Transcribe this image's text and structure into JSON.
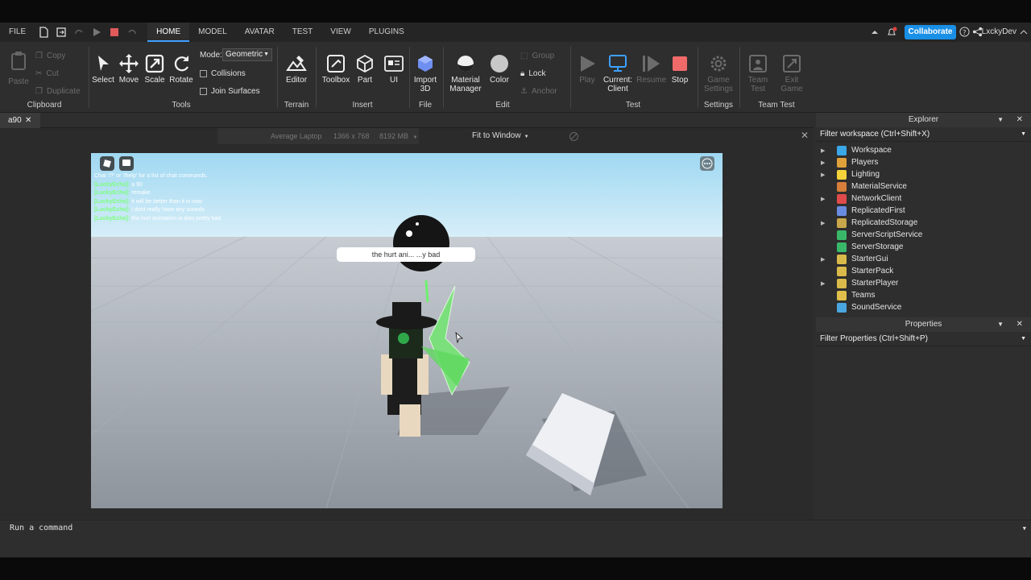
{
  "menu": {
    "file": "FILE",
    "tabs": [
      "HOME",
      "MODEL",
      "AVATAR",
      "TEST",
      "VIEW",
      "PLUGINS"
    ],
    "active_tab": "HOME",
    "collaborate": "Collaborate",
    "username": "LxckyDev"
  },
  "ribbon": {
    "clipboard": {
      "paste": "Paste",
      "copy": "Copy",
      "cut": "Cut",
      "duplicate": "Duplicate",
      "group": "Clipboard"
    },
    "tools": {
      "select": "Select",
      "move": "Move",
      "scale": "Scale",
      "rotate": "Rotate",
      "mode_label": "Mode:",
      "mode_value": "Geometric",
      "collisions": "Collisions",
      "join_surfaces": "Join Surfaces",
      "group": "Tools"
    },
    "terrain": {
      "editor": "Editor",
      "group": "Terrain"
    },
    "insert": {
      "toolbox": "Toolbox",
      "part": "Part",
      "ui": "UI",
      "group": "Insert"
    },
    "file": {
      "import_line1": "Import",
      "import_line2": "3D",
      "group": "File"
    },
    "edit": {
      "material_line1": "Material",
      "material_line2": "Manager",
      "color": "Color",
      "group_btn": "Group",
      "lock": "Lock",
      "anchor": "Anchor",
      "group": "Edit"
    },
    "test": {
      "play": "Play",
      "current_line1": "Current:",
      "current_line2": "Client",
      "resume": "Resume",
      "stop": "Stop",
      "group": "Test"
    },
    "settings": {
      "game_line1": "Game",
      "game_line2": "Settings",
      "group": "Settings"
    },
    "teamtest": {
      "team_line1": "Team",
      "team_line2": "Test",
      "exit_line1": "Exit",
      "exit_line2": "Game",
      "group": "Team Test"
    }
  },
  "doc_tab": "a90",
  "viewport": {
    "device": "Average Laptop",
    "resolution": "1366 x 768",
    "memory": "8192 MB",
    "fit": "Fit to Window"
  },
  "chat": [
    {
      "name": "",
      "text": "Chat '/?' or '/help' for a list of chat commands."
    },
    {
      "name": "[LuckyEcho]:",
      "text": "a 90"
    },
    {
      "name": "[LuckyEcho]:",
      "text": "remake"
    },
    {
      "name": "[LuckyEcho]:",
      "text": "it will be better than it is now"
    },
    {
      "name": "[LuckyEcho]:",
      "text": "i dont really have any sounds"
    },
    {
      "name": "[LuckyEcho]:",
      "text": "the hurt animation is also pretty bad"
    }
  ],
  "bubble": "the hurt ani...   ...y bad",
  "explorer": {
    "title": "Explorer",
    "filter": "Filter workspace (Ctrl+Shift+X)",
    "items": [
      {
        "label": "Workspace",
        "arrow": true,
        "color": "#3aa7e6"
      },
      {
        "label": "Players",
        "arrow": true,
        "color": "#e0a13a"
      },
      {
        "label": "Lighting",
        "arrow": true,
        "color": "#f3d23a"
      },
      {
        "label": "MaterialService",
        "arrow": false,
        "color": "#d67e3a"
      },
      {
        "label": "NetworkClient",
        "arrow": true,
        "color": "#e04a4a"
      },
      {
        "label": "ReplicatedFirst",
        "arrow": false,
        "color": "#6a8ce0"
      },
      {
        "label": "ReplicatedStorage",
        "arrow": true,
        "color": "#c9a64a"
      },
      {
        "label": "ServerScriptService",
        "arrow": false,
        "color": "#3ab86a"
      },
      {
        "label": "ServerStorage",
        "arrow": false,
        "color": "#3ab86a"
      },
      {
        "label": "StarterGui",
        "arrow": true,
        "color": "#d9b94a"
      },
      {
        "label": "StarterPack",
        "arrow": false,
        "color": "#d9b94a"
      },
      {
        "label": "StarterPlayer",
        "arrow": true,
        "color": "#d9b94a"
      },
      {
        "label": "Teams",
        "arrow": false,
        "color": "#e0c04a"
      },
      {
        "label": "SoundService",
        "arrow": false,
        "color": "#4aa6e0"
      }
    ]
  },
  "properties": {
    "title": "Properties",
    "filter": "Filter Properties (Ctrl+Shift+P)"
  },
  "command_bar": {
    "placeholder": "Run a command"
  }
}
